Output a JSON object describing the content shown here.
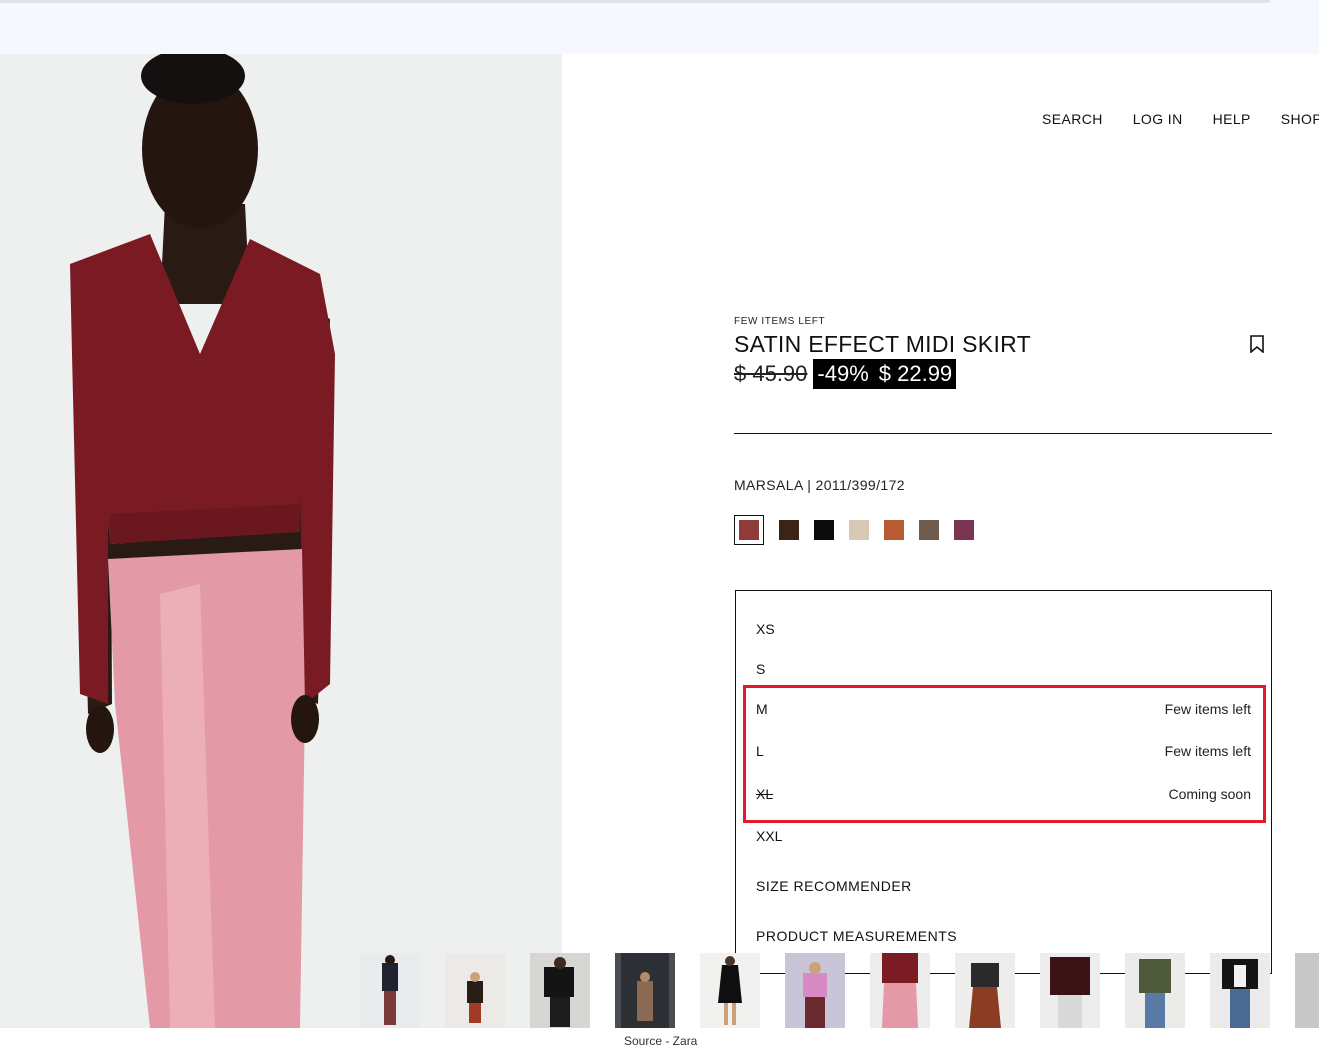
{
  "nav": {
    "search": "SEARCH",
    "login": "LOG IN",
    "help": "HELP",
    "shop": "SHOP"
  },
  "product": {
    "badge": "FEW ITEMS LEFT",
    "title": "SATIN EFFECT MIDI SKIRT",
    "old_price": "$ 45.90",
    "discount": "-49%",
    "new_price": "$ 22.99",
    "color_ref": "MARSALA | 2011/399/172"
  },
  "swatches": [
    {
      "name": "marsala",
      "color": "#8f3b3a",
      "selected": true
    },
    {
      "name": "dark-brown",
      "color": "#3a2418"
    },
    {
      "name": "black",
      "color": "#0c0c0c"
    },
    {
      "name": "sand",
      "color": "#d8c8b4"
    },
    {
      "name": "rust",
      "color": "#b85a33"
    },
    {
      "name": "taupe",
      "color": "#6e5c4c"
    },
    {
      "name": "plum",
      "color": "#7a3552"
    }
  ],
  "sizes": [
    {
      "label": "XS",
      "status": ""
    },
    {
      "label": "S",
      "status": ""
    },
    {
      "label": "M",
      "status": "Few items left"
    },
    {
      "label": "L",
      "status": "Few items left"
    },
    {
      "label": "XL",
      "status": "Coming soon"
    },
    {
      "label": "XXL",
      "status": ""
    }
  ],
  "size_links": {
    "recommender": "SIZE RECOMMENDER",
    "measurements": "PRODUCT MEASUREMENTS"
  },
  "caption": "Source - Zara",
  "colors": {
    "highlight": "#e01b2b",
    "sale_bg": "#000000"
  }
}
